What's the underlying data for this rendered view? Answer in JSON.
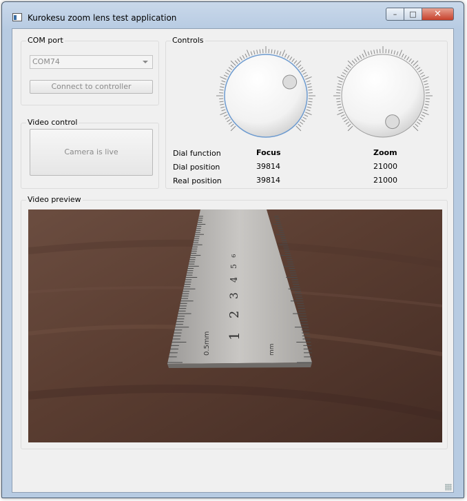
{
  "window": {
    "title": "Kurokesu zoom lens test application",
    "buttons": {
      "minimize": "–",
      "maximize": "□",
      "close": "✕"
    }
  },
  "com_port": {
    "group_label": "COM port",
    "selected_port": "COM74",
    "connect_button": "Connect to controller"
  },
  "video_control": {
    "group_label": "Video control",
    "camera_button": "Camera is live"
  },
  "controls": {
    "group_label": "Controls",
    "row_labels": [
      "Dial function",
      "Dial position",
      "Real position"
    ],
    "dials": [
      {
        "function": "Focus",
        "dial_position": "39814",
        "real_position": "39814",
        "knob_angle_deg": 60,
        "focused": true
      },
      {
        "function": "Zoom",
        "dial_position": "21000",
        "real_position": "21000",
        "knob_angle_deg": 160,
        "focused": false
      }
    ]
  },
  "video_preview": {
    "group_label": "Video preview",
    "ruler_numbers": [
      "1",
      "2",
      "3",
      "4",
      "5",
      "6"
    ],
    "ruler_markings": [
      "0.5mm",
      "mm"
    ]
  },
  "colors": {
    "focus_ring": "#6d9bd0",
    "window_frame": "#b7cbe2",
    "panel": "#f0f0f0",
    "wood": "#5b3f33"
  }
}
